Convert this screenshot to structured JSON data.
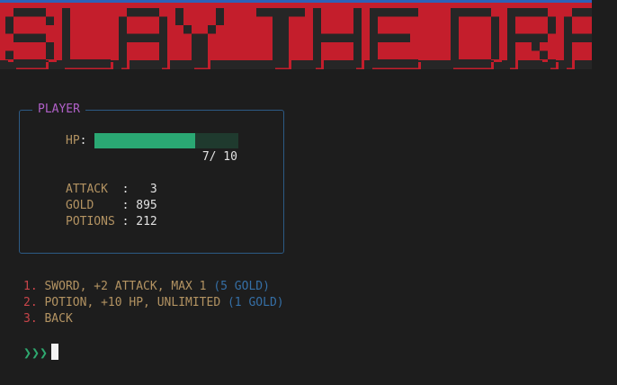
{
  "banner": {
    "title": "SLAY THE DRAGON",
    "color": "#c41e2c"
  },
  "player": {
    "panel_title": "PLAYER",
    "hp_label": "HP",
    "hp_current": 7,
    "hp_max": 10,
    "hp_text": " 7/ 10",
    "stats": [
      {
        "label": "ATTACK  ",
        "value": "  3"
      },
      {
        "label": "GOLD    ",
        "value": "895"
      },
      {
        "label": "POTIONS ",
        "value": "212"
      }
    ]
  },
  "menu": {
    "options": [
      {
        "number": "1.",
        "label": "SWORD, +2 ATTACK, MAX 1",
        "price": "(5 GOLD)"
      },
      {
        "number": "2.",
        "label": "POTION, +10 HP, UNLIMITED",
        "price": "(1 GOLD)"
      },
      {
        "number": "3.",
        "label": "BACK",
        "price": ""
      }
    ]
  },
  "prompt": {
    "symbol": "❯❯❯"
  }
}
